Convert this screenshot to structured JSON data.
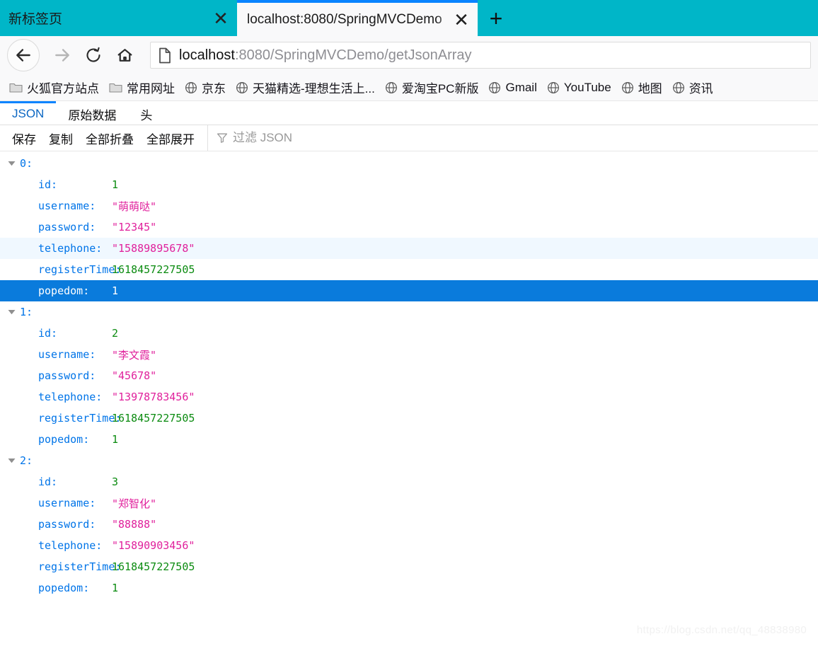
{
  "browser": {
    "tabs": [
      {
        "title": "新标签页",
        "active": false,
        "close_label": "✕"
      },
      {
        "title": "localhost:8080/SpringMVCDemo",
        "active": true,
        "close_label": "✕"
      }
    ],
    "new_tab_label": "+",
    "nav": {
      "back_icon": "arrow-left-icon",
      "forward_icon": "arrow-right-icon",
      "reload_icon": "reload-icon",
      "home_icon": "home-icon"
    },
    "url": {
      "icon": "page-document-icon",
      "host": "localhost",
      "rest": ":8080/SpringMVCDemo/getJsonArray",
      "full": "localhost:8080/SpringMVCDemo/getJsonArray"
    },
    "bookmarks": [
      {
        "label": "火狐官方站点",
        "icon": "folder-icon"
      },
      {
        "label": "常用网址",
        "icon": "folder-icon"
      },
      {
        "label": "京东",
        "icon": "globe-icon"
      },
      {
        "label": "天猫精选-理想生活上...",
        "icon": "globe-icon"
      },
      {
        "label": "爱淘宝PC新版",
        "icon": "globe-icon"
      },
      {
        "label": "Gmail",
        "icon": "globe-icon"
      },
      {
        "label": "YouTube",
        "icon": "globe-icon"
      },
      {
        "label": "地图",
        "icon": "globe-icon"
      },
      {
        "label": "资讯",
        "icon": "globe-icon"
      }
    ]
  },
  "json_viewer": {
    "tabs": [
      {
        "label": "JSON",
        "selected": true
      },
      {
        "label": "原始数据",
        "selected": false
      },
      {
        "label": "头",
        "selected": false
      }
    ],
    "toolbar": {
      "save": "保存",
      "copy": "复制",
      "collapse_all": "全部折叠",
      "expand_all": "全部展开",
      "filter_placeholder": "过滤 JSON",
      "filter_value": "",
      "filter_icon": "funnel-icon"
    },
    "rows": [
      {
        "type": "index",
        "key": "0:",
        "value": "",
        "value_type": "none",
        "state": "normal",
        "expanded": true
      },
      {
        "type": "child",
        "key": "id:",
        "value": "1",
        "value_type": "number",
        "state": "normal"
      },
      {
        "type": "child",
        "key": "username:",
        "value": "\"萌萌哒\"",
        "value_type": "string",
        "state": "normal"
      },
      {
        "type": "child",
        "key": "password:",
        "value": "\"12345\"",
        "value_type": "string",
        "state": "normal"
      },
      {
        "type": "child",
        "key": "telephone:",
        "value": "\"15889895678\"",
        "value_type": "string",
        "state": "hover"
      },
      {
        "type": "child",
        "key": "registerTime:",
        "value": "1618457227505",
        "value_type": "number",
        "state": "normal"
      },
      {
        "type": "child",
        "key": "popedom:",
        "value": "1",
        "value_type": "number",
        "state": "selected"
      },
      {
        "type": "index",
        "key": "1:",
        "value": "",
        "value_type": "none",
        "state": "normal",
        "expanded": true
      },
      {
        "type": "child",
        "key": "id:",
        "value": "2",
        "value_type": "number",
        "state": "normal"
      },
      {
        "type": "child",
        "key": "username:",
        "value": "\"李文霞\"",
        "value_type": "string",
        "state": "normal"
      },
      {
        "type": "child",
        "key": "password:",
        "value": "\"45678\"",
        "value_type": "string",
        "state": "normal"
      },
      {
        "type": "child",
        "key": "telephone:",
        "value": "\"13978783456\"",
        "value_type": "string",
        "state": "normal"
      },
      {
        "type": "child",
        "key": "registerTime:",
        "value": "1618457227505",
        "value_type": "number",
        "state": "normal"
      },
      {
        "type": "child",
        "key": "popedom:",
        "value": "1",
        "value_type": "number",
        "state": "normal"
      },
      {
        "type": "index",
        "key": "2:",
        "value": "",
        "value_type": "none",
        "state": "normal",
        "expanded": true
      },
      {
        "type": "child",
        "key": "id:",
        "value": "3",
        "value_type": "number",
        "state": "normal"
      },
      {
        "type": "child",
        "key": "username:",
        "value": "\"郑智化\"",
        "value_type": "string",
        "state": "normal"
      },
      {
        "type": "child",
        "key": "password:",
        "value": "\"88888\"",
        "value_type": "string",
        "state": "normal"
      },
      {
        "type": "child",
        "key": "telephone:",
        "value": "\"15890903456\"",
        "value_type": "string",
        "state": "normal"
      },
      {
        "type": "child",
        "key": "registerTime:",
        "value": "1618457227505",
        "value_type": "number",
        "state": "normal"
      },
      {
        "type": "child",
        "key": "popedom:",
        "value": "1",
        "value_type": "number",
        "state": "normal"
      }
    ]
  },
  "watermark": "https://blog.csdn.net/qq_48838980",
  "colors": {
    "tabstrip": "#00b6c8",
    "active_tab_accent": "#0a84ff",
    "json_key": "#0074e8",
    "json_number": "#0b8b10",
    "json_string": "#e0219c",
    "row_selected": "#0a7bdc",
    "row_hover": "#f0f8ff"
  }
}
